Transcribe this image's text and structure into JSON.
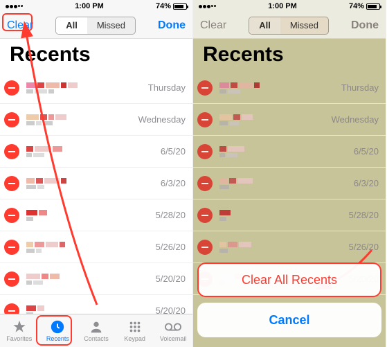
{
  "status": {
    "time": "1:00 PM",
    "battery": "74%"
  },
  "nav": {
    "clear": "Clear",
    "done": "Done",
    "all": "All",
    "missed": "Missed"
  },
  "header": {
    "title": "Recents"
  },
  "rows": [
    {
      "date": "Thursday"
    },
    {
      "date": "Wednesday"
    },
    {
      "date": "6/5/20"
    },
    {
      "date": "6/3/20"
    },
    {
      "date": "5/28/20"
    },
    {
      "date": "5/26/20"
    },
    {
      "date": "5/20/20"
    },
    {
      "date": "5/20/20"
    }
  ],
  "tabs": {
    "favorites": "Favorites",
    "recents": "Recents",
    "contacts": "Contacts",
    "keypad": "Keypad",
    "voicemail": "Voicemail"
  },
  "sheet": {
    "clearall": "Clear All Recents",
    "cancel": "Cancel"
  }
}
